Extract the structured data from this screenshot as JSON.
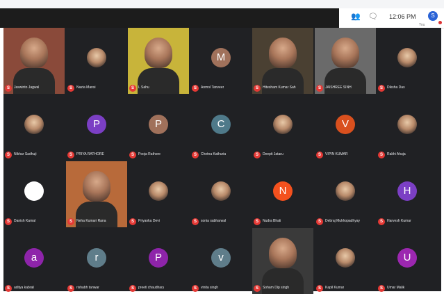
{
  "header": {
    "time": "12:06 PM",
    "you_initial": "S",
    "you_label": "You"
  },
  "participants": [
    {
      "name": "Jaswinto Jagwal",
      "avatar": "video",
      "color": "#8a4a3a"
    },
    {
      "name": "Nazia Mansi",
      "avatar": "photo",
      "color": "#5a3a30"
    },
    {
      "name": "L Sahu",
      "avatar": "video",
      "color": "#c8b43a"
    },
    {
      "name": "Anmol Tanveer",
      "avatar": "letter",
      "letter": "M",
      "color": "#a0715b"
    },
    {
      "name": "Hitesham Kumar Sah",
      "avatar": "video",
      "color": "#4a4032"
    },
    {
      "name": "JAISHREE SINH",
      "avatar": "video",
      "color": "#6a6a6a"
    },
    {
      "name": "Diksha Das",
      "avatar": "photo",
      "color": "#6a5a30"
    },
    {
      "name": "Nikhar Sadhuji",
      "avatar": "photo",
      "color": "#4a3a30"
    },
    {
      "name": "PRIYA RATHORE",
      "avatar": "letter",
      "letter": "P",
      "color": "#7b3fc4"
    },
    {
      "name": "Pooja Rathore",
      "avatar": "letter",
      "letter": "P",
      "color": "#a0715b"
    },
    {
      "name": "Chetna Kathuria",
      "avatar": "letter",
      "letter": "C",
      "color": "#4f7a8a"
    },
    {
      "name": "Deepti Jataru",
      "avatar": "photo",
      "color": "#b09080"
    },
    {
      "name": "VIPIN KUMAR",
      "avatar": "letter",
      "letter": "V",
      "color": "#d9501e"
    },
    {
      "name": "Rakhi Ahuja",
      "avatar": "photo",
      "color": "#b08a30"
    },
    {
      "name": "Danish Kamal",
      "avatar": "logo",
      "color": "#ffffff"
    },
    {
      "name": "Neha Kumari Rana",
      "avatar": "video",
      "color": "#b86a3a"
    },
    {
      "name": "Priyanka Devi",
      "avatar": "photo",
      "color": "#8a4a4a"
    },
    {
      "name": "sonia sabharwal",
      "avatar": "photo",
      "color": "#7a3a50"
    },
    {
      "name": "Nudra Bhati",
      "avatar": "letter",
      "letter": "N",
      "color": "#f4511e"
    },
    {
      "name": "Debraj Mukhopadhyay",
      "avatar": "photo",
      "color": "#5a4a3a"
    },
    {
      "name": "Harvesh Kumar",
      "avatar": "letter",
      "letter": "H",
      "color": "#7b3fc4"
    },
    {
      "name": "aditya kabrali",
      "avatar": "letter",
      "letter": "a",
      "color": "#8e24aa"
    },
    {
      "name": "rishabh tanwar",
      "avatar": "letter",
      "letter": "r",
      "color": "#5f7d8a"
    },
    {
      "name": "preeti chaudhary",
      "avatar": "letter",
      "letter": "P",
      "color": "#8e24aa"
    },
    {
      "name": "vinita singh",
      "avatar": "letter",
      "letter": "v",
      "color": "#5f7d8a"
    },
    {
      "name": "Soham Dip singh",
      "avatar": "video",
      "color": "#3a3a3a"
    },
    {
      "name": "Kapil Kumar",
      "avatar": "photo",
      "color": "#6a6a6a"
    },
    {
      "name": "Umar Malik",
      "avatar": "letter",
      "letter": "U",
      "color": "#9c27b0"
    }
  ]
}
